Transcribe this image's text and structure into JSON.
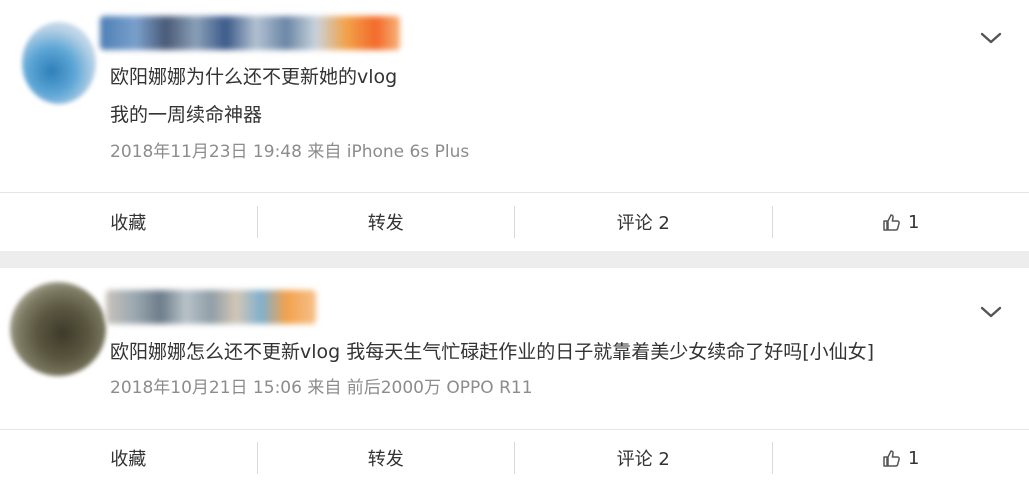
{
  "posts": [
    {
      "text_lines": [
        "欧阳娜娜为什么还不更新她的vlog",
        "我的一周续命神器"
      ],
      "meta": "2018年11月23日 19:48 来自 iPhone 6s Plus",
      "actions": {
        "favorite": "收藏",
        "repost": "转发",
        "comment": "评论 2",
        "like_count": "1"
      },
      "icons": {
        "menu": "chevron-down-icon",
        "like": "thumbs-up-icon"
      }
    },
    {
      "text_lines": [
        "欧阳娜娜怎么还不更新vlog 我每天生气忙碌赶作业的日子就靠着美少女续命了好吗[小仙女]"
      ],
      "meta": "2018年10月21日 15:06 来自 前后2000万 OPPO R11",
      "actions": {
        "favorite": "收藏",
        "repost": "转发",
        "comment": "评论 2",
        "like_count": "1"
      },
      "icons": {
        "menu": "chevron-down-icon",
        "like": "thumbs-up-icon"
      }
    }
  ],
  "colors": {
    "background": "#ededed",
    "card": "#ffffff",
    "meta_text": "#8c8c8c",
    "divider": "#d9d9d9"
  }
}
